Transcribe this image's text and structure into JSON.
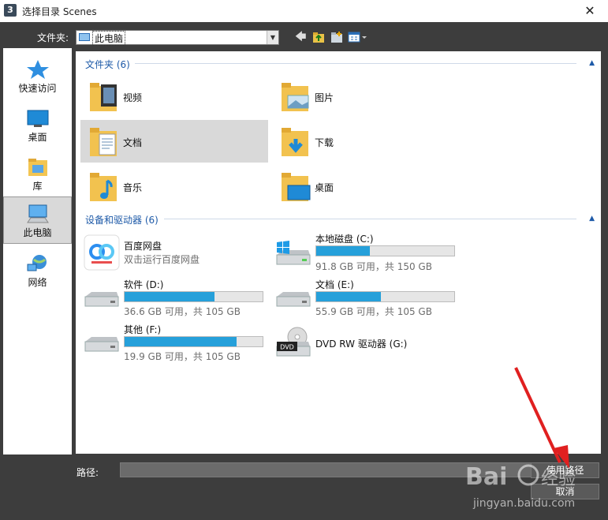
{
  "window": {
    "title": "选择目录 Scenes",
    "app_icon_text": "3",
    "close_glyph": "✕"
  },
  "toolbar": {
    "folder_label": "文件夹:",
    "location": "此电脑"
  },
  "sidebar": {
    "items": [
      {
        "label": "快速访问",
        "icon": "star-icon"
      },
      {
        "label": "桌面",
        "icon": "desktop-icon"
      },
      {
        "label": "库",
        "icon": "library-icon"
      },
      {
        "label": "此电脑",
        "icon": "computer-icon",
        "selected": true
      },
      {
        "label": "网络",
        "icon": "network-icon"
      }
    ]
  },
  "folders": {
    "header": "文件夹 (6)",
    "items": [
      {
        "label": "视频",
        "icon": "video-folder-icon"
      },
      {
        "label": "图片",
        "icon": "pictures-folder-icon"
      },
      {
        "label": "文档",
        "icon": "documents-folder-icon",
        "selected": true
      },
      {
        "label": "下载",
        "icon": "downloads-folder-icon"
      },
      {
        "label": "音乐",
        "icon": "music-folder-icon"
      },
      {
        "label": "桌面",
        "icon": "desktop-folder-icon"
      }
    ]
  },
  "devices": {
    "header": "设备和驱动器 (6)",
    "items": [
      {
        "name": "百度网盘",
        "sub": "双击运行百度网盘",
        "icon": "baidu-netdisk-icon"
      },
      {
        "name": "本地磁盘 (C:)",
        "sub": "91.8 GB 可用，共 150 GB",
        "used_fraction": 0.39,
        "icon": "windows-drive-icon"
      },
      {
        "name": "软件 (D:)",
        "sub": "36.6 GB 可用，共 105 GB",
        "used_fraction": 0.65,
        "icon": "hard-drive-icon"
      },
      {
        "name": "文档 (E:)",
        "sub": "55.9 GB 可用，共 105 GB",
        "used_fraction": 0.47,
        "icon": "hard-drive-icon"
      },
      {
        "name": "其他 (F:)",
        "sub": "19.9 GB 可用，共 105 GB",
        "used_fraction": 0.81,
        "icon": "hard-drive-icon"
      },
      {
        "name": "DVD RW 驱动器 (G:)",
        "icon": "dvd-drive-icon",
        "dvd_text": "DVD"
      }
    ]
  },
  "bottom": {
    "path_label": "路径:",
    "path_value": "",
    "use_path_label": "使用路径",
    "cancel_label": "取消"
  },
  "colors": {
    "accent": "#1e5aa8",
    "bar_fill": "#26a0da",
    "dark_bg": "#3d3d3d",
    "arrow": "#e02020"
  }
}
